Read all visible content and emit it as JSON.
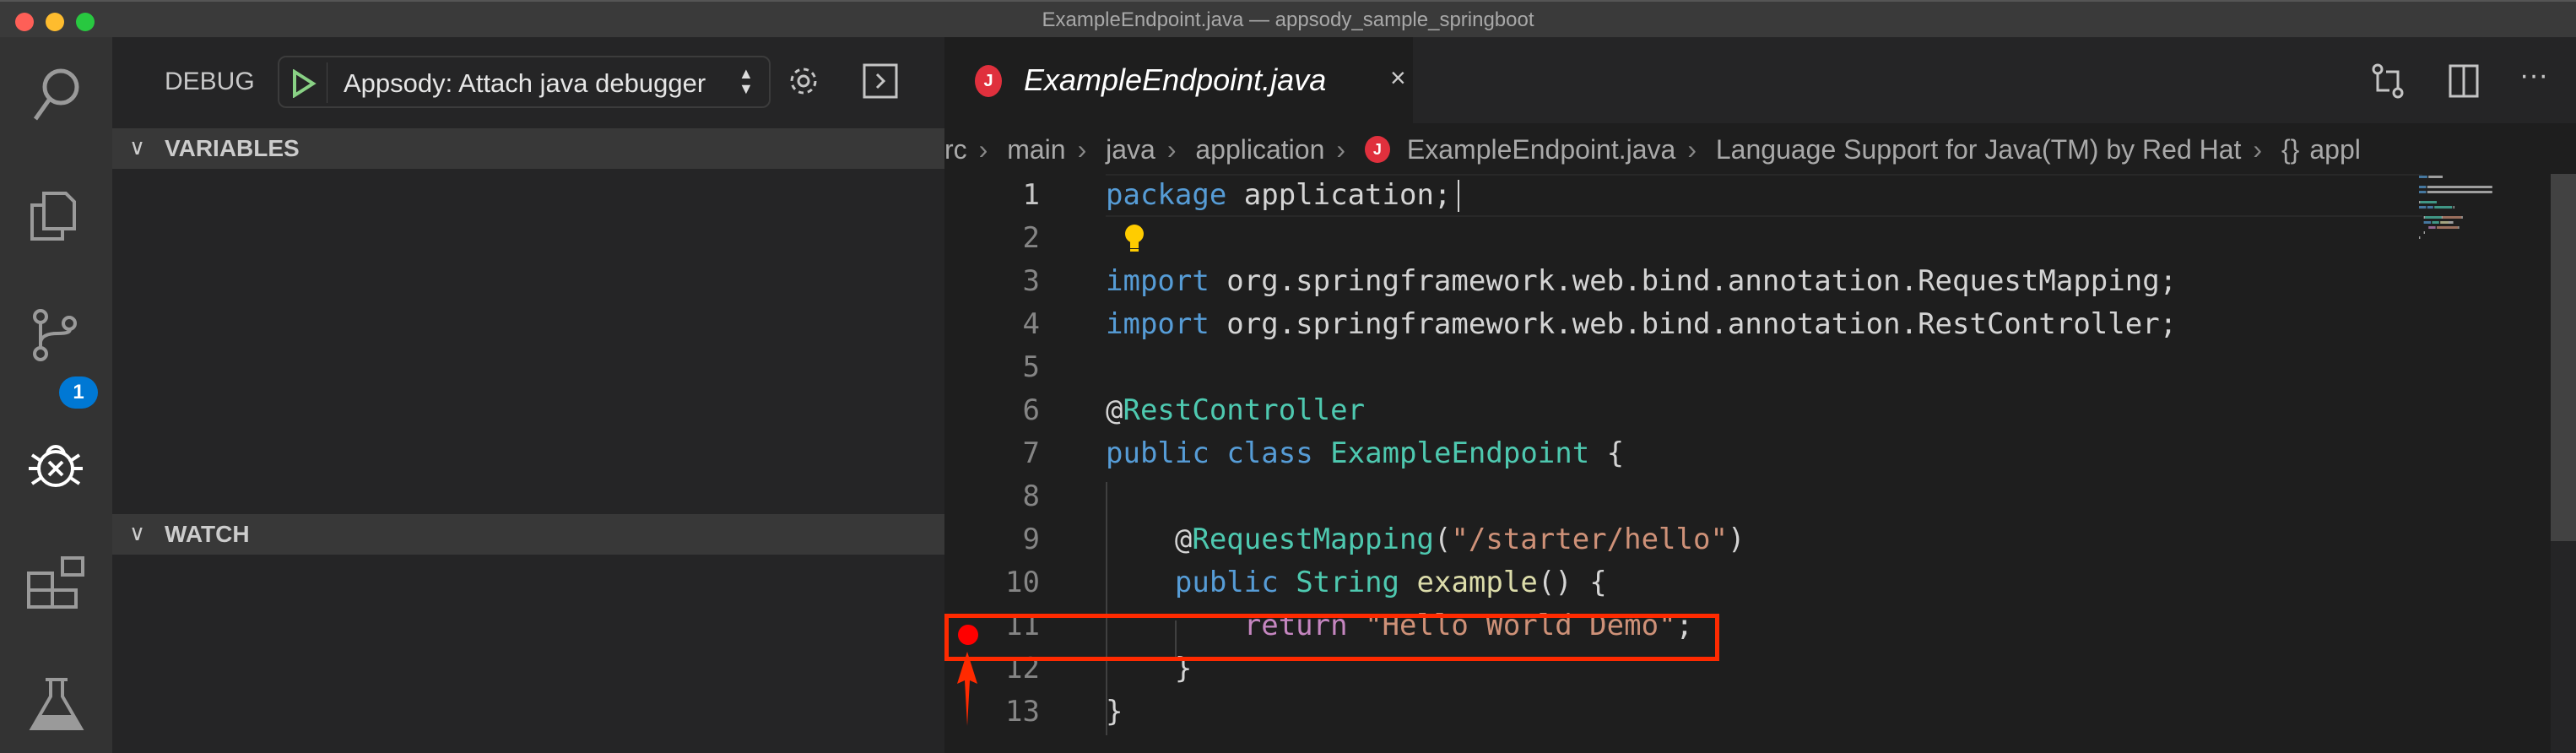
{
  "window": {
    "title": "ExampleEndpoint.java — appsody_sample_springboot"
  },
  "colors": {
    "accent": "#0078d4",
    "breakpoint": "#ff0000",
    "annotation_box": "#ff2a00",
    "java_icon": "#e0303d"
  },
  "activity_bar": {
    "items": [
      {
        "icon": "search-icon"
      },
      {
        "icon": "files-icon"
      },
      {
        "icon": "source-control-icon",
        "badge": "1"
      },
      {
        "icon": "debug-icon",
        "active": true
      },
      {
        "icon": "extensions-icon"
      },
      {
        "icon": "flask-icon"
      }
    ]
  },
  "sidebar": {
    "title": "DEBUG",
    "config": "Appsody: Attach java debugger",
    "sections": {
      "variables": "VARIABLES",
      "watch": "WATCH"
    }
  },
  "editor": {
    "tab": {
      "label": "ExampleEndpoint.java",
      "icon_letter": "J"
    },
    "breadcrumb": [
      "rc",
      "main",
      "java",
      "application",
      "ExampleEndpoint.java",
      "Language Support for Java(TM) by Red Hat",
      "appl"
    ],
    "breadcrumb_symbol": "{}",
    "breakpoint_line": 11,
    "lines": [
      {
        "n": "1",
        "tokens": [
          [
            "package",
            "kw"
          ],
          [
            " application;",
            "pl"
          ]
        ]
      },
      {
        "n": "2",
        "tokens": []
      },
      {
        "n": "3",
        "tokens": [
          [
            "import",
            "kw"
          ],
          [
            " org.springframework.web.bind.annotation.RequestMapping;",
            "pl"
          ]
        ]
      },
      {
        "n": "4",
        "tokens": [
          [
            "import",
            "kw"
          ],
          [
            " org.springframework.web.bind.annotation.RestController;",
            "pl"
          ]
        ]
      },
      {
        "n": "5",
        "tokens": []
      },
      {
        "n": "6",
        "tokens": [
          [
            "@",
            "pl"
          ],
          [
            "RestController",
            "ty"
          ]
        ]
      },
      {
        "n": "7",
        "tokens": [
          [
            "public",
            "kw"
          ],
          [
            " ",
            "pl"
          ],
          [
            "class",
            "kw"
          ],
          [
            " ",
            "pl"
          ],
          [
            "ExampleEndpoint",
            "ty"
          ],
          [
            " {",
            "pl"
          ]
        ]
      },
      {
        "n": "8",
        "tokens": []
      },
      {
        "n": "9",
        "tokens": [
          [
            "    @",
            "pl"
          ],
          [
            "RequestMapping",
            "ty"
          ],
          [
            "(",
            "pl"
          ],
          [
            "\"/starter/hello\"",
            "st"
          ],
          [
            ")",
            "pl"
          ]
        ]
      },
      {
        "n": "10",
        "tokens": [
          [
            "    ",
            "pl"
          ],
          [
            "public",
            "kw"
          ],
          [
            " ",
            "pl"
          ],
          [
            "String",
            "ty"
          ],
          [
            " ",
            "pl"
          ],
          [
            "example",
            "fn"
          ],
          [
            "() {",
            "pl"
          ]
        ]
      },
      {
        "n": "11",
        "tokens": [
          [
            "        ",
            "pl"
          ],
          [
            "return",
            "ct"
          ],
          [
            " ",
            "pl"
          ],
          [
            "\"Hello World Demo\"",
            "st"
          ],
          [
            ";",
            "pl"
          ]
        ]
      },
      {
        "n": "12",
        "tokens": [
          [
            "    }",
            "pl"
          ]
        ]
      },
      {
        "n": "13",
        "tokens": [
          [
            "}",
            "pl"
          ]
        ]
      }
    ]
  },
  "token_colors": {
    "kw": "#569cd6",
    "ty": "#4ec9b0",
    "st": "#ce9178",
    "fn": "#dcdcaa",
    "ct": "#c586c0",
    "pl": "#d4d4d4"
  }
}
